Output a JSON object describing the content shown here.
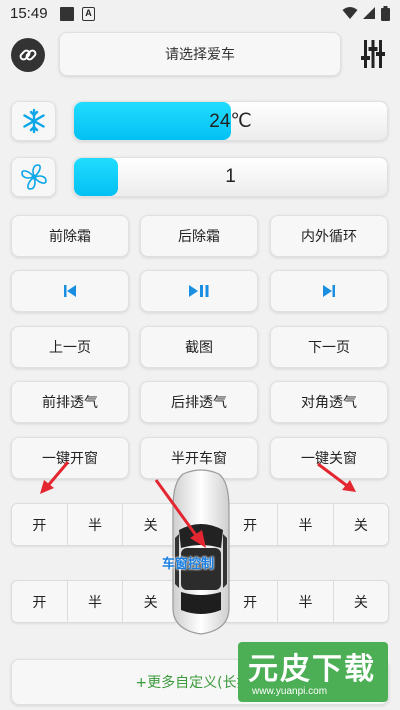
{
  "status_bar": {
    "time": "15:49",
    "app_badge": "A"
  },
  "header": {
    "car_select_label": "请选择爱车"
  },
  "climate": {
    "temperature": {
      "label": "24℃",
      "fill_fraction": 0.5
    },
    "fan": {
      "label": "1",
      "fill_fraction": 0.14
    },
    "colors": {
      "bar_fill": "#12cff7"
    }
  },
  "buttons": {
    "front_defrost": "前除霜",
    "rear_defrost": "后除霜",
    "recirculation": "内外循环",
    "prev_track_icon": "skip-previous-icon",
    "play_pause_icon": "play-pause-icon",
    "next_track_icon": "skip-next-icon",
    "prev_page": "上一页",
    "screenshot": "截图",
    "next_page": "下一页",
    "front_vent": "前排透气",
    "rear_vent": "后排透气",
    "diagonal_vent": "对角透气",
    "open_all_windows": "一键开窗",
    "half_open_windows": "半开车窗",
    "close_all_windows": "一键关窗"
  },
  "windows": {
    "seg_open": "开",
    "seg_half": "半",
    "seg_close": "关",
    "car_label": "车窗控制"
  },
  "footer": {
    "more_custom": "+更多自定义(长按自"
  },
  "watermark": {
    "title": "元皮下载",
    "url": "www.yuanpi.com"
  }
}
